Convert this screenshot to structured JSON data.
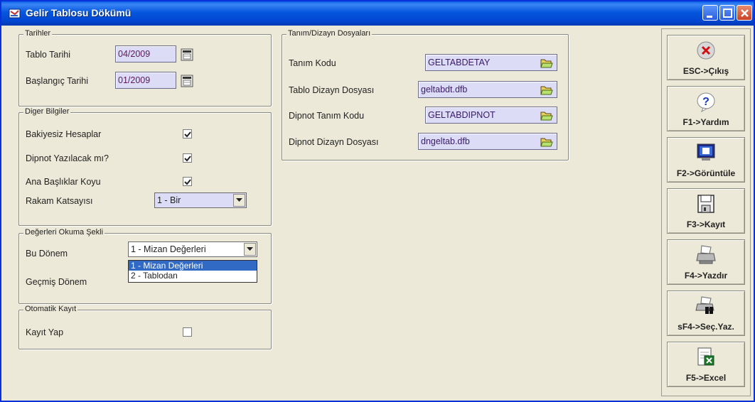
{
  "window": {
    "title": "Gelir Tablosu Dökümü"
  },
  "tarihler": {
    "legend": "Tarihler",
    "tablo_tarihi_label": "Tablo Tarihi",
    "tablo_tarihi_value": "04/2009",
    "baslangic_tarihi_label": "Başlangıç Tarihi",
    "baslangic_tarihi_value": "01/2009"
  },
  "diger": {
    "legend": "Diger Bilgiler",
    "bakiyesiz_label": "Bakiyesiz Hesaplar",
    "bakiyesiz_checked": true,
    "dipnot_label": "Dipnot Yazılacak mı?",
    "dipnot_checked": true,
    "ana_baslik_label": "Ana Başlıklar Koyu",
    "ana_baslik_checked": true,
    "rakam_label": "Rakam Katsayısı",
    "rakam_value": "1 - Bir"
  },
  "okuma": {
    "legend": "Değerleri Okuma Şekli",
    "bu_donem_label": "Bu Dönem",
    "bu_donem_value": "1 - Mizan Değerleri",
    "gecmis_donem_label": "Geçmiş Dönem",
    "options": [
      "1 - Mizan Değerleri",
      "2 - Tablodan"
    ]
  },
  "otomatik": {
    "legend": "Otomatik Kayıt",
    "kayit_label": "Kayıt Yap",
    "kayit_checked": false
  },
  "tanim": {
    "legend": "Tanım/Dizayn Dosyaları",
    "tanim_kodu_label": "Tanım Kodu",
    "tanim_kodu_value": "GELTABDETAY",
    "tablo_dizayn_label": "Tablo Dizayn Dosyası",
    "tablo_dizayn_value": "geltabdt.dfb",
    "dipnot_tanim_label": "Dipnot Tanım Kodu",
    "dipnot_tanim_value": "GELTABDIPNOT",
    "dipnot_dizayn_label": "Dipnot Dizayn Dosyası",
    "dipnot_dizayn_value": "dngeltab.dfb"
  },
  "toolbar": {
    "esc": "ESC->Çıkış",
    "f1": "F1->Yardım",
    "f2": "F2->Görüntüle",
    "f3": "F3->Kayıt",
    "f4": "F4->Yazdır",
    "sf4": "sF4->Seç.Yaz.",
    "f5": "F5->Excel"
  },
  "colors": {
    "title_bar": "#0246d1",
    "field_bg": "#dcdcf6",
    "selection": "#316ac5"
  }
}
